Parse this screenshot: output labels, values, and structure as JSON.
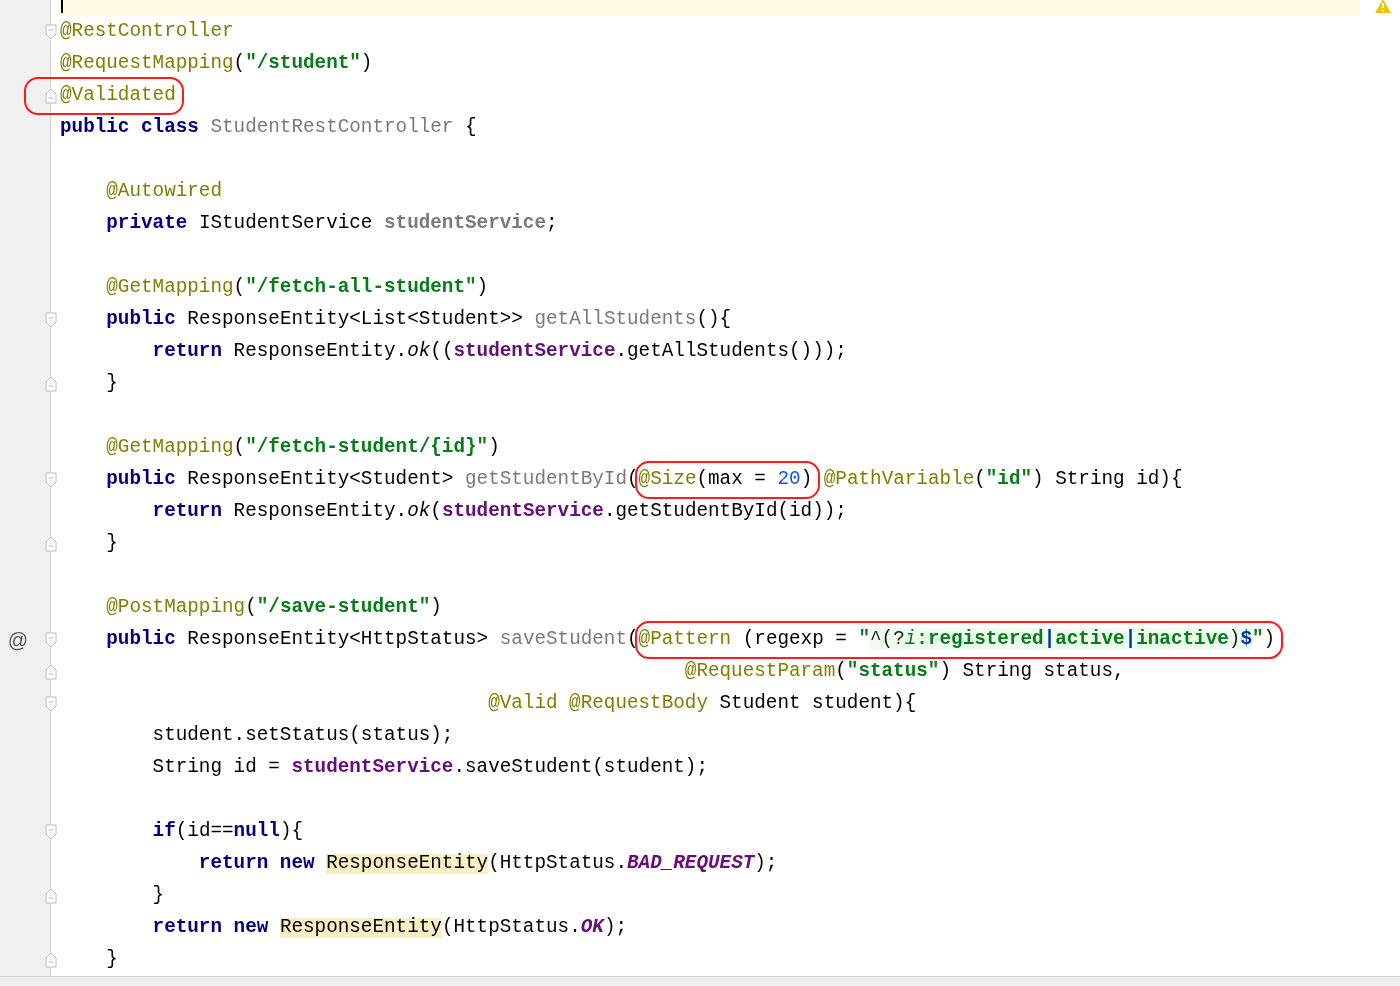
{
  "editor": {
    "current_line": {
      "caret": true
    },
    "lines": [
      {
        "fold_start": true,
        "tokens": [
          {
            "kind": "ann",
            "text": "@RestController"
          }
        ]
      },
      {
        "tokens": [
          {
            "kind": "ann",
            "text": "@RequestMapping"
          },
          {
            "kind": "plain",
            "text": "("
          },
          {
            "kind": "str",
            "text": "\"/student\""
          },
          {
            "kind": "plain",
            "text": ")"
          }
        ]
      },
      {
        "fold_end": true,
        "tokens": [
          {
            "kind": "circle",
            "into_gutter": true,
            "tokens": [
              {
                "kind": "ann",
                "text": "@Validated"
              }
            ]
          }
        ]
      },
      {
        "tokens": [
          {
            "kind": "kw",
            "text": "public class "
          },
          {
            "kind": "decl",
            "text": "StudentRestController"
          },
          {
            "kind": "plain",
            "text": " {"
          }
        ]
      },
      {
        "gap_before": true,
        "tokens": [
          {
            "kind": "ann",
            "text": "    @Autowired"
          }
        ]
      },
      {
        "tokens": [
          {
            "kind": "kw",
            "text": "    private"
          },
          {
            "kind": "plain",
            "text": " IStudentService "
          },
          {
            "kind": "declb",
            "text": "studentService"
          },
          {
            "kind": "plain",
            "text": ";"
          }
        ]
      },
      {
        "gap_before": true,
        "tokens": [
          {
            "kind": "ann",
            "text": "    @GetMapping"
          },
          {
            "kind": "plain",
            "text": "("
          },
          {
            "kind": "str",
            "text": "\"/fetch-all-student\""
          },
          {
            "kind": "plain",
            "text": ")"
          }
        ]
      },
      {
        "fold_start": true,
        "tokens": [
          {
            "kind": "kw",
            "text": "    public"
          },
          {
            "kind": "plain",
            "text": " ResponseEntity<List<Student>> "
          },
          {
            "kind": "decl",
            "text": "getAllStudents"
          },
          {
            "kind": "plain",
            "text": "(){"
          }
        ]
      },
      {
        "tokens": [
          {
            "kind": "kw",
            "text": "        return"
          },
          {
            "kind": "plain",
            "text": " ResponseEntity."
          },
          {
            "kind": "italic",
            "text": "ok"
          },
          {
            "kind": "plain",
            "text": "(("
          },
          {
            "kind": "field",
            "text": "studentService"
          },
          {
            "kind": "plain",
            "text": ".getAllStudents()));"
          }
        ]
      },
      {
        "fold_end": true,
        "tokens": [
          {
            "kind": "plain",
            "text": "    }"
          }
        ]
      },
      {
        "gap_before": true,
        "tokens": [
          {
            "kind": "ann",
            "text": "    @GetMapping"
          },
          {
            "kind": "plain",
            "text": "("
          },
          {
            "kind": "str",
            "text": "\"/fetch-student/{id}\""
          },
          {
            "kind": "plain",
            "text": ")"
          }
        ]
      },
      {
        "fold_start": true,
        "tokens": [
          {
            "kind": "kw",
            "text": "    public"
          },
          {
            "kind": "plain",
            "text": " ResponseEntity<Student> "
          },
          {
            "kind": "decl",
            "text": "getStudentById"
          },
          {
            "kind": "plain",
            "text": "("
          },
          {
            "kind": "circle",
            "tokens": [
              {
                "kind": "ann",
                "text": "@Size"
              },
              {
                "kind": "plain",
                "text": "(max = "
              },
              {
                "kind": "num",
                "text": "20"
              },
              {
                "kind": "plain",
                "text": ")"
              }
            ]
          },
          {
            "kind": "ann",
            "text": " @PathVariable"
          },
          {
            "kind": "plain",
            "text": "("
          },
          {
            "kind": "str",
            "text": "\"id\""
          },
          {
            "kind": "plain",
            "text": ") String id){"
          }
        ]
      },
      {
        "tokens": [
          {
            "kind": "kw",
            "text": "        return"
          },
          {
            "kind": "plain",
            "text": " ResponseEntity."
          },
          {
            "kind": "italic",
            "text": "ok"
          },
          {
            "kind": "plain",
            "text": "("
          },
          {
            "kind": "field",
            "text": "studentService"
          },
          {
            "kind": "plain",
            "text": ".getStudentById(id));"
          }
        ]
      },
      {
        "fold_end": true,
        "tokens": [
          {
            "kind": "plain",
            "text": "    }"
          }
        ]
      },
      {
        "gap_before": true,
        "tokens": [
          {
            "kind": "ann",
            "text": "    @PostMapping"
          },
          {
            "kind": "plain",
            "text": "("
          },
          {
            "kind": "str",
            "text": "\"/save-student\""
          },
          {
            "kind": "plain",
            "text": ")"
          }
        ]
      },
      {
        "marker": "@",
        "fold_start": true,
        "tokens": [
          {
            "kind": "kw",
            "text": "    public"
          },
          {
            "kind": "plain",
            "text": " ResponseEntity<HttpStatus> "
          },
          {
            "kind": "decl",
            "text": "saveStudent"
          },
          {
            "kind": "plain",
            "text": "("
          },
          {
            "kind": "circle",
            "tokens": [
              {
                "kind": "ann",
                "text": "@Pattern"
              },
              {
                "kind": "plain",
                "text": " (regexp = "
              },
              {
                "kind": "str",
                "text": "\""
              },
              {
                "kind": "reop",
                "text": "^(?"
              },
              {
                "kind": "rei",
                "text": "i"
              },
              {
                "kind": "re",
                "text": ":registered"
              },
              {
                "kind": "repipe",
                "text": "|"
              },
              {
                "kind": "re",
                "text": "active"
              },
              {
                "kind": "repipe",
                "text": "|"
              },
              {
                "kind": "re",
                "text": "inactive"
              },
              {
                "kind": "reop",
                "text": ")"
              },
              {
                "kind": "repipe",
                "text": "$"
              },
              {
                "kind": "str",
                "text": "\""
              },
              {
                "kind": "plain",
                "text": ")"
              }
            ]
          }
        ]
      },
      {
        "fold_end": true,
        "tokens": [
          {
            "kind": "ann",
            "text": "                                                      @RequestParam"
          },
          {
            "kind": "plain",
            "text": "("
          },
          {
            "kind": "str",
            "text": "\"status\""
          },
          {
            "kind": "plain",
            "text": ") String status,"
          }
        ]
      },
      {
        "fold_start": true,
        "tokens": [
          {
            "kind": "ann",
            "text": "                                     @Valid @RequestBody"
          },
          {
            "kind": "plain",
            "text": " Student student){"
          }
        ]
      },
      {
        "tokens": [
          {
            "kind": "plain",
            "text": "        student.setStatus(status);"
          }
        ]
      },
      {
        "tokens": [
          {
            "kind": "plain",
            "text": "        String id = "
          },
          {
            "kind": "field",
            "text": "studentService"
          },
          {
            "kind": "plain",
            "text": ".saveStudent(student);"
          }
        ]
      },
      {
        "gap_before": true,
        "fold_start": true,
        "tokens": [
          {
            "kind": "kw",
            "text": "        if"
          },
          {
            "kind": "plain",
            "text": "(id=="
          },
          {
            "kind": "kw",
            "text": "null"
          },
          {
            "kind": "plain",
            "text": "){"
          }
        ]
      },
      {
        "tokens": [
          {
            "kind": "kw",
            "text": "            return new "
          },
          {
            "kind": "hl",
            "text": "ResponseEntity"
          },
          {
            "kind": "plain",
            "text": "(HttpStatus."
          },
          {
            "kind": "static",
            "text": "BAD_REQUEST"
          },
          {
            "kind": "plain",
            "text": ");"
          }
        ]
      },
      {
        "fold_end": true,
        "tokens": [
          {
            "kind": "plain",
            "text": "        }"
          }
        ]
      },
      {
        "tokens": [
          {
            "kind": "kw",
            "text": "        return new "
          },
          {
            "kind": "hl",
            "text": "ResponseEntity"
          },
          {
            "kind": "plain",
            "text": "(HttpStatus."
          },
          {
            "kind": "static",
            "text": "OK"
          },
          {
            "kind": "plain",
            "text": ");"
          }
        ]
      },
      {
        "fold_end": true,
        "tokens": [
          {
            "kind": "plain",
            "text": "    }"
          }
        ]
      }
    ]
  }
}
